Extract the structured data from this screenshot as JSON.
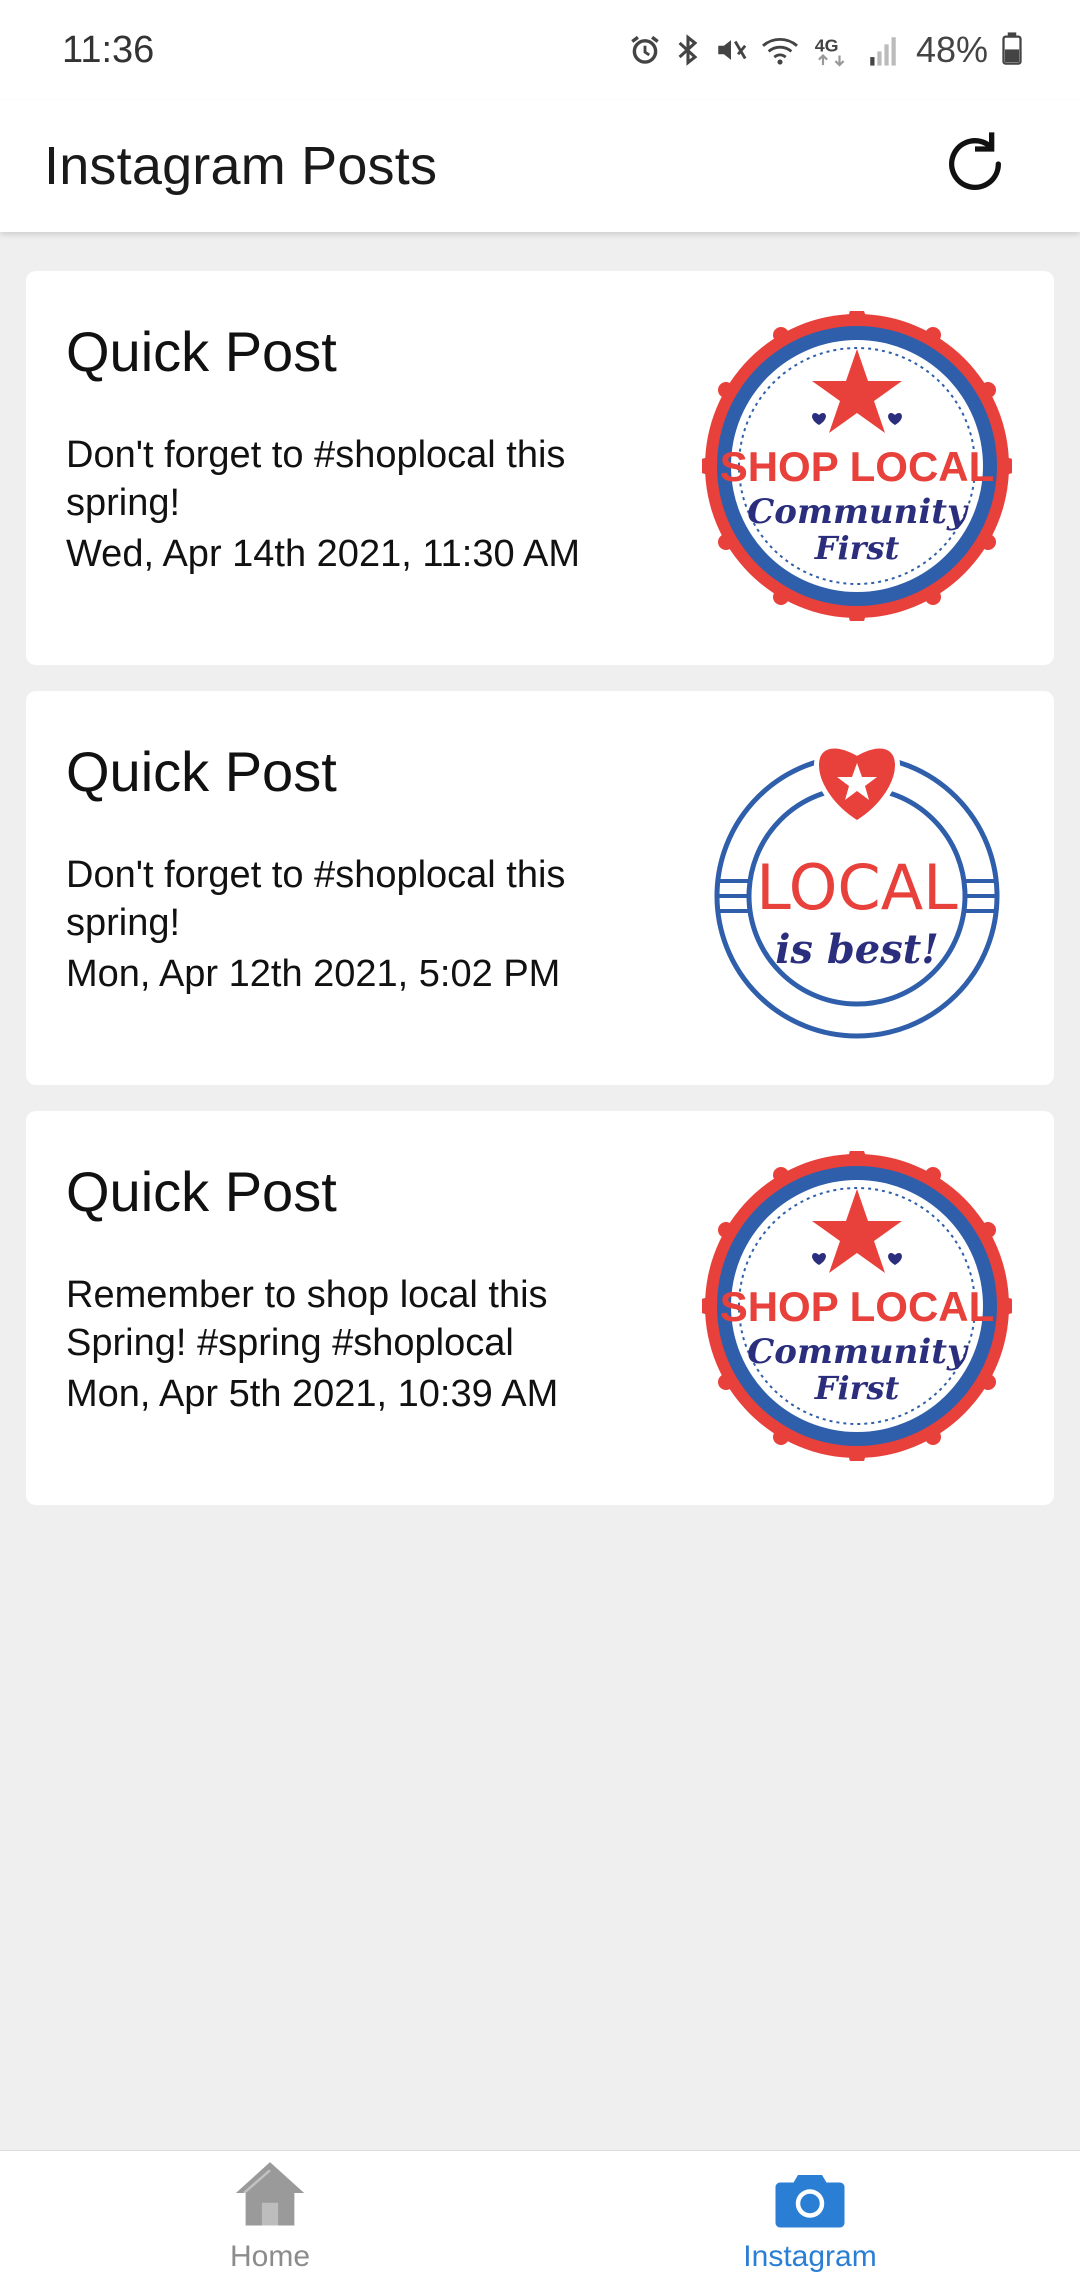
{
  "status_bar": {
    "time": "11:36",
    "battery_percent": "48%",
    "network_label": "4G",
    "icons": [
      "alarm-icon",
      "bluetooth-icon",
      "mute-icon",
      "wifi-icon",
      "network-4g-icon",
      "signal-icon",
      "battery-icon"
    ]
  },
  "app_bar": {
    "title": "Instagram Posts",
    "refresh_icon": "refresh-icon"
  },
  "posts": [
    {
      "title": "Quick Post",
      "caption": "Don't forget to #shoplocal this spring!",
      "date": "Wed, Apr 14th 2021, 11:30 AM",
      "image": {
        "kind": "shop-local-badge",
        "line1": "SHOP LOCAL",
        "line2": "Community",
        "line3": "First"
      }
    },
    {
      "title": "Quick Post",
      "caption": "Don't forget to #shoplocal this spring!",
      "date": "Mon, Apr 12th 2021, 5:02 PM",
      "image": {
        "kind": "local-is-best-badge",
        "line1": "LOCAL",
        "line2": "is best!"
      }
    },
    {
      "title": "Quick Post",
      "caption": "Remember to shop local this Spring! #spring #shoplocal",
      "date": "Mon, Apr 5th 2021, 10:39 AM",
      "image": {
        "kind": "shop-local-badge",
        "line1": "SHOP LOCAL",
        "line2": "Community",
        "line3": "First"
      }
    }
  ],
  "bottom_nav": {
    "items": [
      {
        "label": "Home",
        "icon": "home-icon",
        "active": false
      },
      {
        "label": "Instagram",
        "icon": "camera-icon",
        "active": true
      }
    ]
  },
  "colors": {
    "badge_red": "#e8403a",
    "badge_blue": "#2f5faa",
    "badge_navy": "#2a2e7c",
    "nav_active": "#2a7fd4",
    "nav_inactive": "#8c8c8c",
    "background": "#efefef"
  }
}
